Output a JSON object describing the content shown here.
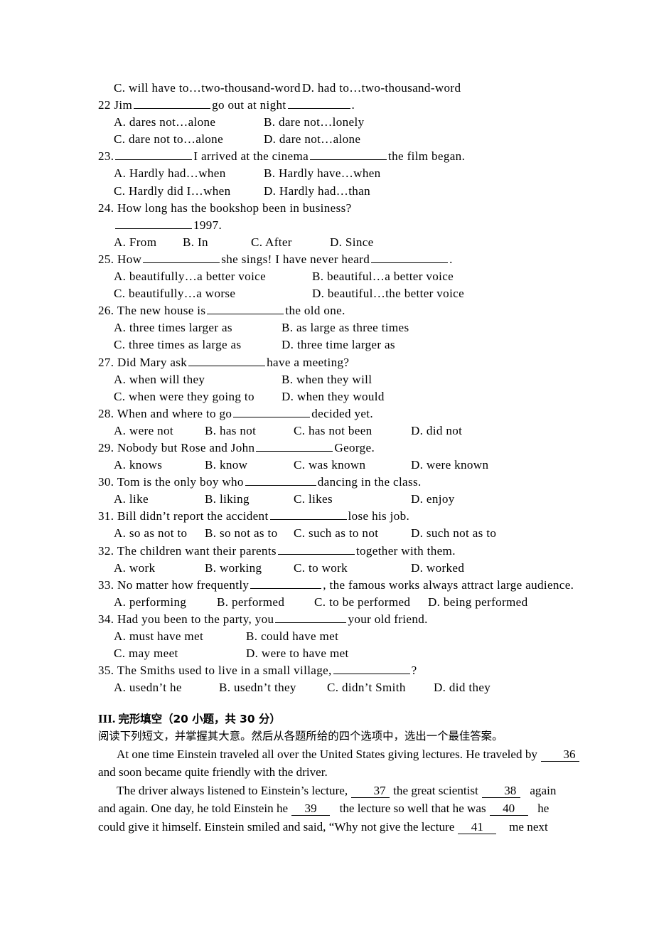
{
  "page": {
    "doc_type": "english-exam-paper",
    "background": "#ffffff",
    "text_color": "#000000"
  },
  "top_options_continued": {
    "option_c": "C. will have to…two-thousand-word",
    "option_d": "D. had to…two-thousand-word"
  },
  "questions": [
    {
      "number": "22",
      "stem_before": "Jim",
      "stem_middle": "go out at night",
      "stem_after": ".",
      "options_layout": "two-column",
      "options": [
        "A. dares not…alone",
        "B. dare not…lonely",
        "C. dare not to…alone",
        "D. dare not…alone"
      ]
    },
    {
      "number": "23.",
      "stem_before": "",
      "stem_middle": "I arrived at the cinema",
      "stem_after": "the film began.",
      "options_layout": "two-column",
      "options": [
        "A. Hardly had…when",
        "B. Hardly have…when",
        "C. Hardly did I…when",
        "D. Hardly had…than"
      ]
    },
    {
      "number": "24.",
      "stem_before": "How long has the bookshop been in business?",
      "stem_middle": "",
      "stem_after": "1997.",
      "options_layout": "four-column",
      "options": [
        "A. From",
        "B. In",
        "C. After",
        "D. Since"
      ]
    },
    {
      "number": "25.",
      "stem_before": "How",
      "stem_middle": "she sings! I have never heard",
      "stem_after": ".",
      "options_layout": "two-column",
      "options": [
        "A. beautifully…a better voice",
        "B. beautiful…a better voice",
        "C. beautifully…a worse",
        "D. beautiful…the better voice"
      ]
    },
    {
      "number": "26.",
      "stem_before": "The new house is",
      "stem_middle": "",
      "stem_after": "the old one.",
      "options_layout": "two-column",
      "options": [
        "A. three times larger as",
        "B. as large as three times",
        "C. three times as large as",
        "D. three time larger as"
      ]
    },
    {
      "number": "27.",
      "stem_before": "Did Mary ask",
      "stem_middle": "",
      "stem_after": "have a meeting?",
      "options_layout": "two-column",
      "options": [
        "A. when will they",
        "B. when they will",
        "C. when were they going to",
        "D. when they would"
      ]
    },
    {
      "number": "28.",
      "stem_before": "When and where to go",
      "stem_middle": "",
      "stem_after": "decided yet.",
      "options_layout": "four-column",
      "options": [
        "A. were not",
        "B. has not",
        "C. has not been",
        "D. did not"
      ]
    },
    {
      "number": "29.",
      "stem_before": "Nobody but Rose and John",
      "stem_middle": "",
      "stem_after": "George.",
      "options_layout": "four-column",
      "options": [
        "A. knows",
        "B. know",
        "C. was known",
        "D. were known"
      ]
    },
    {
      "number": "30.",
      "stem_before": "Tom is the only boy who",
      "stem_middle": "",
      "stem_after": "dancing in the class.",
      "options_layout": "four-column",
      "options": [
        "A. like",
        "B. liking",
        "C. likes",
        "D. enjoy"
      ]
    },
    {
      "number": "31.",
      "stem_before": "Bill didn’t report the accident",
      "stem_middle": "",
      "stem_after": "lose his job.",
      "options_layout": "four-column",
      "options": [
        "A. so as not to",
        "B. so not as to",
        "C. such as to not",
        "D. such not as to"
      ]
    },
    {
      "number": "32.",
      "stem_before": "The children want their parents",
      "stem_middle": "",
      "stem_after": "together with them.",
      "options_layout": "four-column",
      "options": [
        "A. work",
        "B. working",
        "C. to work",
        "D. worked"
      ]
    },
    {
      "number": "33.",
      "stem_before": "No matter how frequently",
      "stem_middle": "",
      "stem_after": ", the famous works always attract large audience.",
      "options_layout": "four-column",
      "options": [
        "A. performing",
        "B. performed",
        "C. to be performed",
        "D. being performed"
      ]
    },
    {
      "number": "34.",
      "stem_before": "Had you been to the party, you",
      "stem_middle": "",
      "stem_after": "your old friend.",
      "options_layout": "two-column",
      "options": [
        "A. must have met",
        "B. could have met",
        "C. may meet",
        "D. were to have met"
      ]
    },
    {
      "number": "35.",
      "stem_before": "The Smiths used to live in a small village,",
      "stem_middle": "",
      "stem_after": "?",
      "options_layout": "four-column",
      "options": [
        "A. usedn’t he",
        "B. usedn’t they",
        "C. didn’t Smith",
        "D. did they"
      ]
    }
  ],
  "section3": {
    "heading_roman": "III.",
    "heading_cn": "完形填空（20 小题，共 30 分）",
    "instruction_cn": "阅读下列短文，并掌握其大意。然后从各题所给的四个选项中，选出一个最佳答案。",
    "passage": {
      "p1_part1": "At one time Einstein traveled all over the United States giving lectures. He traveled by",
      "p1_blank1": "36",
      "p1_part2": "and soon became quite friendly with the driver.",
      "p2_part1": "The driver always listened to Einstein’s lecture,",
      "p2_blank1": "37",
      "p2_part2": "the great scientist",
      "p2_blank2": "38",
      "p2_part3": "again",
      "p2_part4": "and again. One day, he told Einstein he",
      "p2_blank3": "39",
      "p2_part5": "the lecture so well that he was",
      "p2_blank4": "40",
      "p2_part6": "he",
      "p2_part7": "could give it himself. Einstein smiled and said, “Why not give the lecture",
      "p2_blank5": "41",
      "p2_part8": "me next"
    }
  }
}
